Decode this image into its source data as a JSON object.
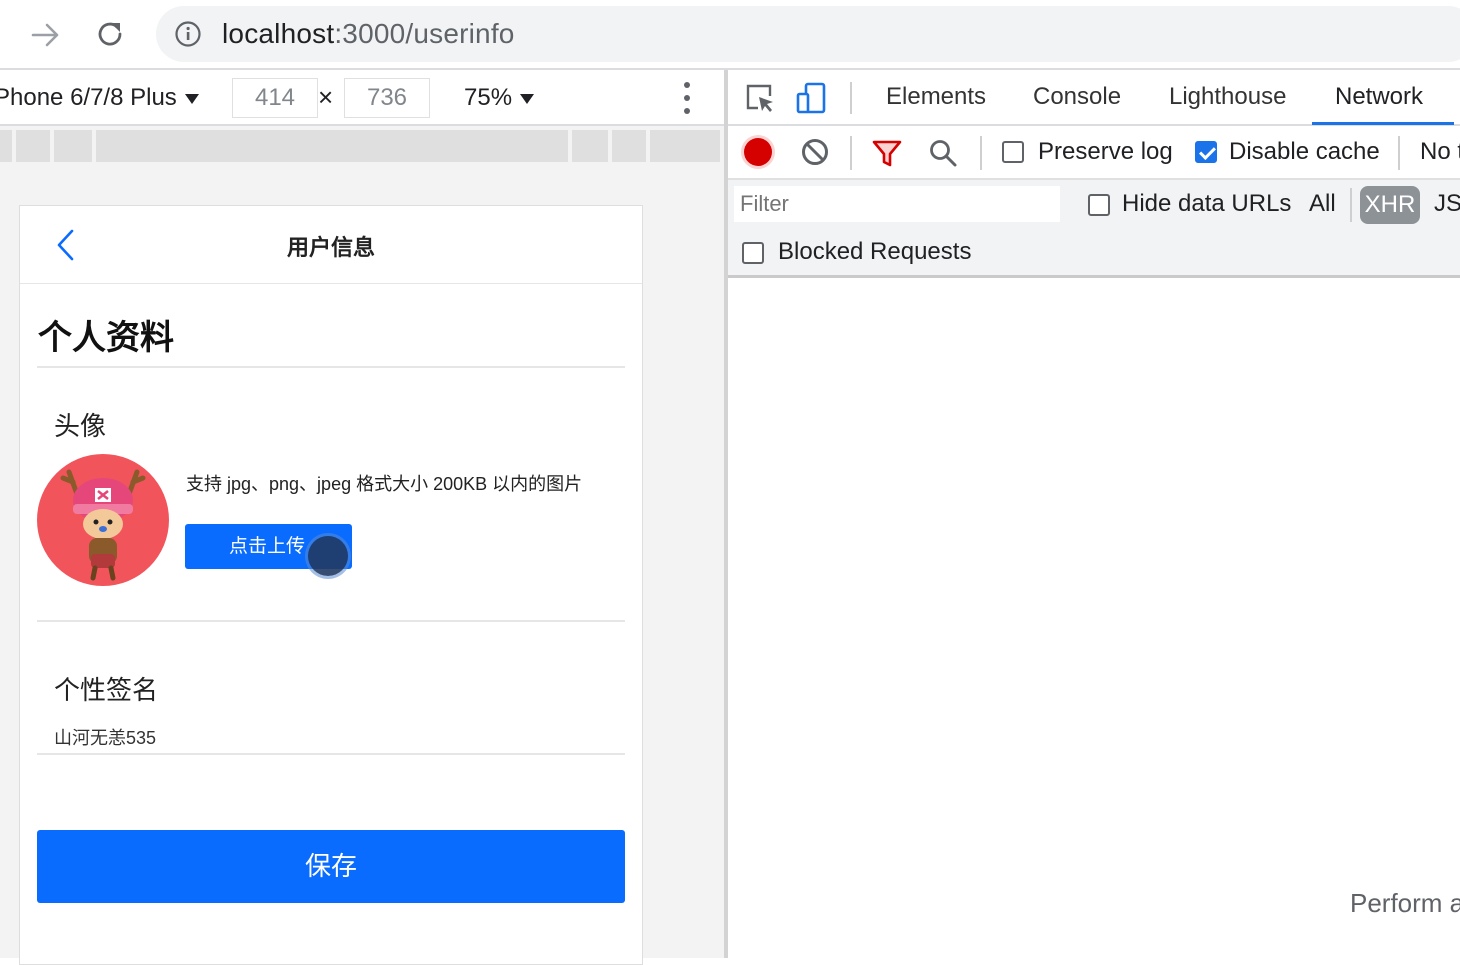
{
  "browser": {
    "url_host": "localhost",
    "url_path": ":3000/userinfo"
  },
  "device_toolbar": {
    "device": "Phone 6/7/8 Plus",
    "width": "414",
    "height": "736",
    "times": "×",
    "zoom": "75%"
  },
  "page": {
    "header_title": "用户信息",
    "section_title": "个人资料",
    "avatar_label": "头像",
    "upload_hint": "支持 jpg、png、jpeg 格式大小 200KB 以内的图片",
    "upload_button": "点击上传",
    "signature_label": "个性签名",
    "signature_value": "山河无恙535",
    "save_button": "保存"
  },
  "devtools": {
    "tabs": [
      "Elements",
      "Console",
      "Lighthouse",
      "Network"
    ],
    "active_tab": "Network",
    "preserve_log": "Preserve log",
    "disable_cache": "Disable cache",
    "no_throttle": "No t",
    "filter_placeholder": "Filter",
    "hide_data_urls": "Hide data URLs",
    "all": "All",
    "xhr": "XHR",
    "js": "JS",
    "blocked_requests": "Blocked Requests",
    "perform_hint": "Perform a"
  },
  "colors": {
    "primary": "#0a6cff",
    "record": "#d50000",
    "tab_active": "#1a73e8"
  }
}
